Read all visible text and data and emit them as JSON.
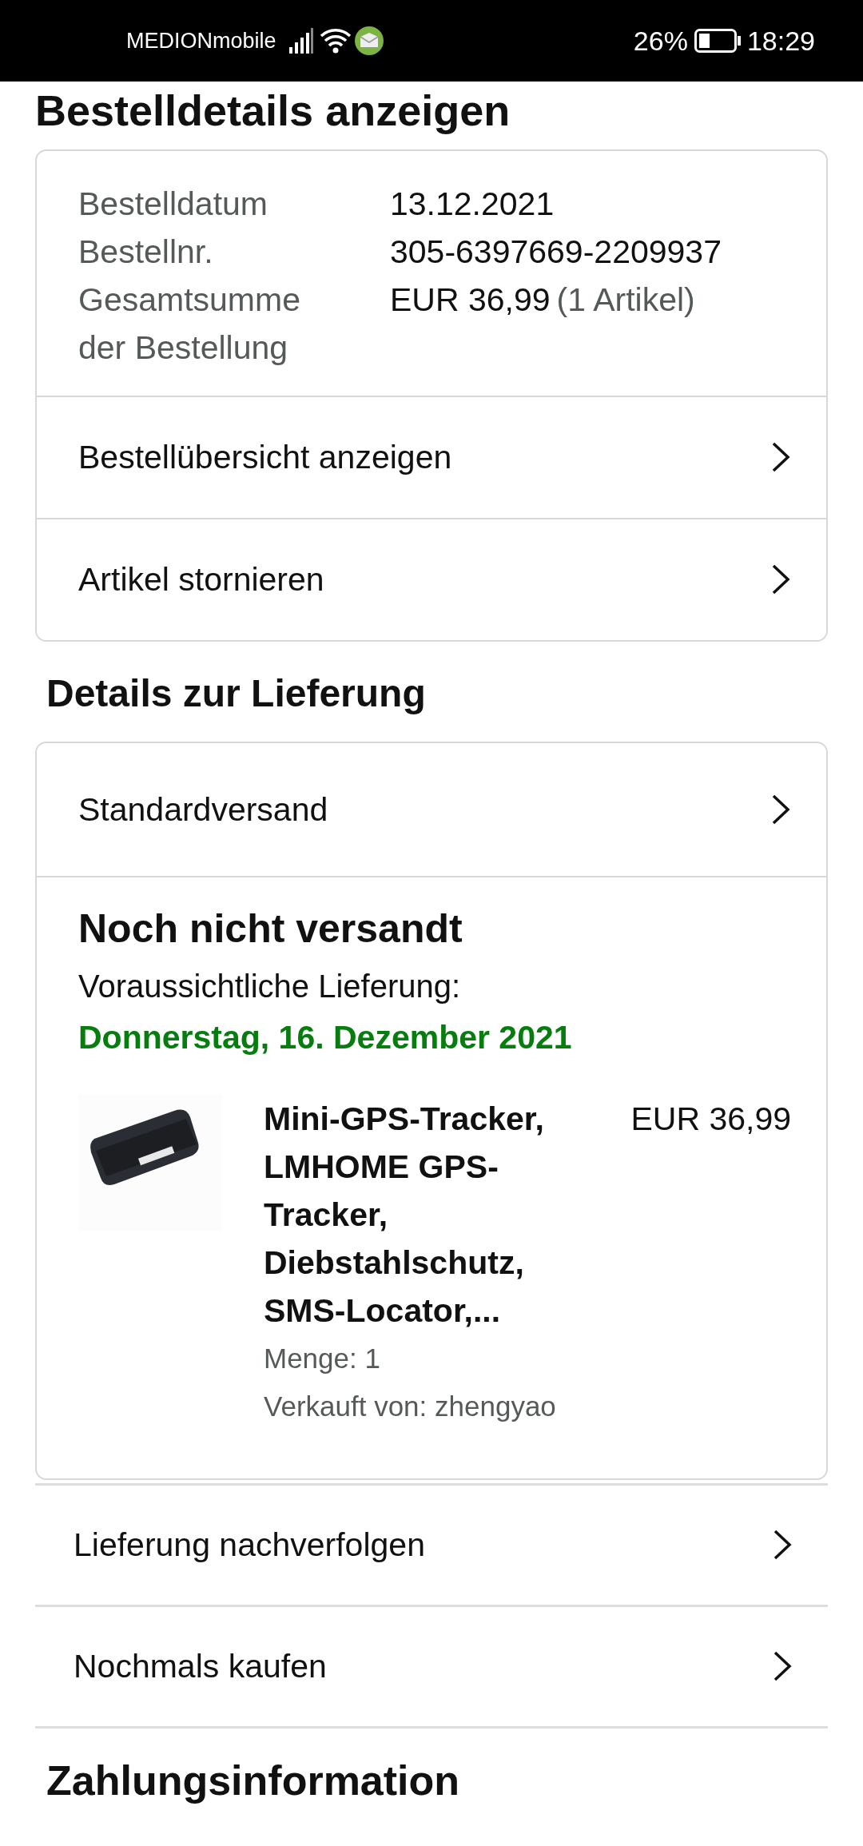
{
  "status_bar": {
    "carrier": "MEDIONmobile",
    "battery": "26%",
    "time": "18:29"
  },
  "page_title": "Bestelldetails anzeigen",
  "order_summary": {
    "fields": [
      {
        "label": "Bestelldatum",
        "value": "13.12.2021"
      },
      {
        "label": "Bestellnr.",
        "value": "305-6397669-2209937"
      },
      {
        "label": "Gesamtsumme der Bestellung",
        "value": "EUR 36,99",
        "note": "(1 Artikel)"
      }
    ],
    "links": [
      "Bestellübersicht anzeigen",
      "Artikel stornieren"
    ]
  },
  "delivery": {
    "heading": "Details zur Lieferung",
    "shipping_method": "Standardversand",
    "status": "Noch nicht versandt",
    "eta_label": "Voraussichtliche Lieferung:",
    "eta_date": "Donnerstag, 16. Dezember 2021",
    "items": [
      {
        "title": "Mini-GPS-Tracker, LMHOME GPS-Tracker, Diebstahlschutz, SMS-Locator,...",
        "price": "EUR 36,99",
        "quantity": "Menge: 1",
        "seller": "Verkauft von: zhengyao"
      }
    ],
    "actions": [
      "Lieferung nachverfolgen",
      "Nochmals kaufen"
    ]
  },
  "payment": {
    "heading": "Zahlungsinformation"
  }
}
